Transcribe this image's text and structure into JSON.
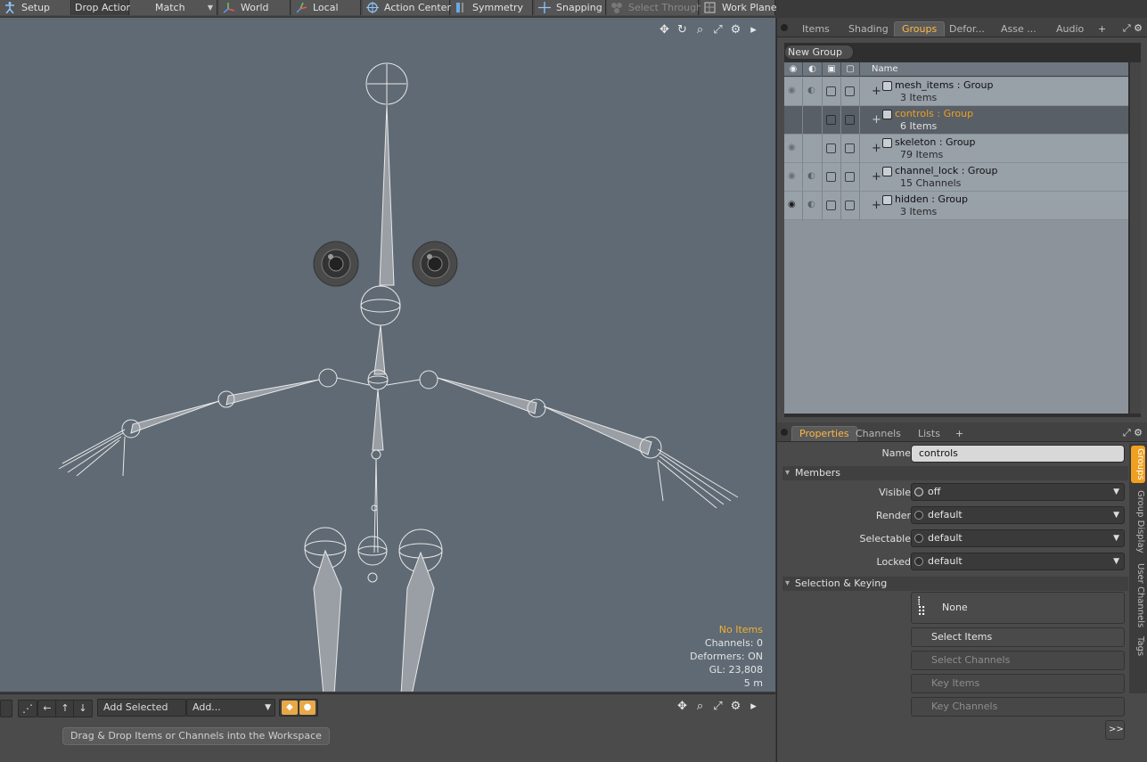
{
  "toolbar": {
    "setup": "Setup",
    "drop_action": "Drop Action",
    "match": "Match",
    "world": "World",
    "local": "Local",
    "action_center": "Action Center",
    "symmetry": "Symmetry",
    "snapping": "Snapping",
    "select_through": "Select Through",
    "work_plane": "Work Plane"
  },
  "viewport": {
    "stats": {
      "items": "No Items",
      "channels": "Channels: 0",
      "deformers": "Deformers: ON",
      "gl": "GL: 23,808",
      "distance": "5 m"
    }
  },
  "workspace": {
    "add_selected": "Add Selected",
    "add_menu": "Add...",
    "dropzone": "Drag & Drop Items or Channels into the Workspace"
  },
  "top_tabs": [
    "Items",
    "Shading",
    "Groups",
    "Defor...",
    "Asse ...",
    "Audio"
  ],
  "groups": {
    "new_group": "New Group",
    "name_header": "Name",
    "rows": [
      {
        "name": "mesh_items",
        "type": " : Group",
        "count": "3 Items"
      },
      {
        "name": "controls",
        "type": " : Group",
        "count": "6 Items"
      },
      {
        "name": "skeleton",
        "type": " : Group",
        "count": "79 Items"
      },
      {
        "name": "channel_lock",
        "type": " : Group",
        "count": "15 Channels"
      },
      {
        "name": "hidden",
        "type": " : Group",
        "count": "3 Items"
      }
    ]
  },
  "bottom_tabs": [
    "Properties",
    "Channels",
    "Lists"
  ],
  "properties": {
    "name_label": "Name",
    "name_value": "controls",
    "members_section": "Members",
    "visible_label": "Visible",
    "visible_value": "off",
    "render_label": "Render",
    "render_value": "default",
    "selectable_label": "Selectable",
    "selectable_value": "default",
    "locked_label": "Locked",
    "locked_value": "default",
    "selkey_section": "Selection & Keying",
    "none_btn": "None",
    "select_items": "Select Items",
    "select_channels": "Select Channels",
    "key_items": "Key Items",
    "key_channels": "Key Channels",
    "more": ">>"
  },
  "side_tabs": [
    "Groups",
    "Group Display",
    "User Channels",
    "Tags"
  ]
}
